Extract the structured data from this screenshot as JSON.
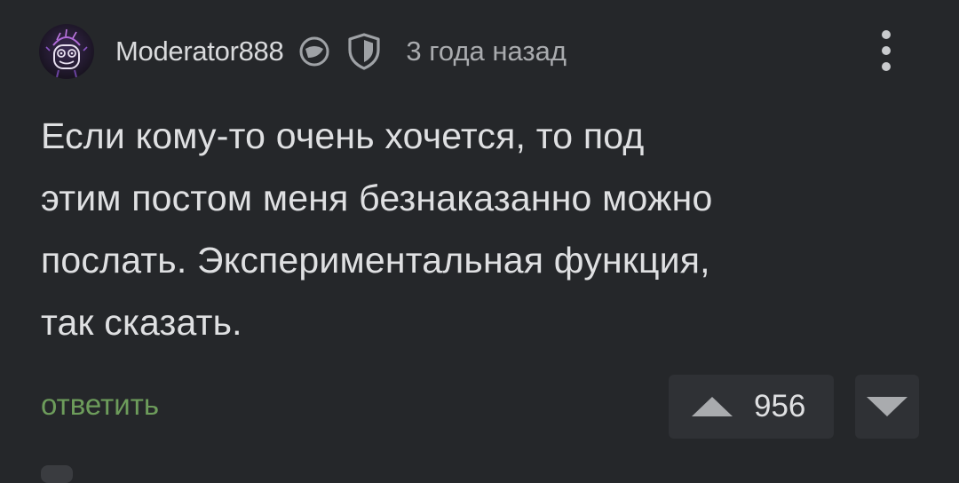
{
  "comment": {
    "author": "Moderator888",
    "badges": [
      "moderator-badge-icon",
      "shield-icon"
    ],
    "time": "3 года назад",
    "body": "Если кому-то очень хочется, то под\nэтим постом меня безнаказанно можно\nпослать. Экспериментальная функция,\nтак сказать.",
    "reply_label": "ответить",
    "rating": "956"
  },
  "colors": {
    "background": "#25272a",
    "text": "#dfe0e2",
    "muted": "#a9abae",
    "reply": "#6d9c5b",
    "vote_bg": "#2f3135"
  }
}
